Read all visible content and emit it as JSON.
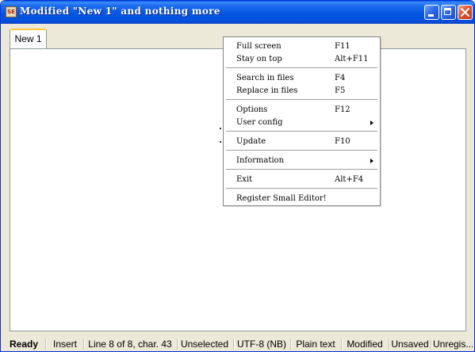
{
  "window": {
    "title": "Modified \"New 1\" and nothing more",
    "app_icon": "SE"
  },
  "tabs": [
    {
      "label": "New 1",
      "active": true
    }
  ],
  "context_menu": {
    "items": [
      {
        "label": "Full screen",
        "accel": "F11"
      },
      {
        "label": "Stay on top",
        "accel": "Alt+F11"
      },
      {
        "label": "Search in files",
        "accel": "F4"
      },
      {
        "label": "Replace in files",
        "accel": "F5"
      },
      {
        "label": "Options",
        "accel": "F12"
      },
      {
        "label": "User config",
        "accel": "",
        "submenu": true
      },
      {
        "label": "Update",
        "accel": "F10"
      },
      {
        "label": "Information",
        "accel": "",
        "submenu": true
      },
      {
        "label": "Exit",
        "accel": "Alt+F4"
      },
      {
        "label": "Register Small Editor!",
        "accel": ""
      }
    ]
  },
  "statusbar": {
    "state": "Ready",
    "mode": "Insert",
    "position": "Line 8 of 8, char. 43",
    "selection": "Unselected",
    "encoding": "UTF-8 (NB)",
    "syntax": "Plain text",
    "modified": "Modified",
    "saved": "Unsaved",
    "registration": "Unregis..."
  },
  "colors": {
    "titlebar": "#0556e2",
    "tab_highlight": "#ffc83c",
    "close_button": "#e0502a"
  },
  "icons": {
    "minimize": "minimize-icon",
    "maximize": "maximize-icon",
    "close": "close-icon",
    "submenu": "chevron-right-icon"
  }
}
